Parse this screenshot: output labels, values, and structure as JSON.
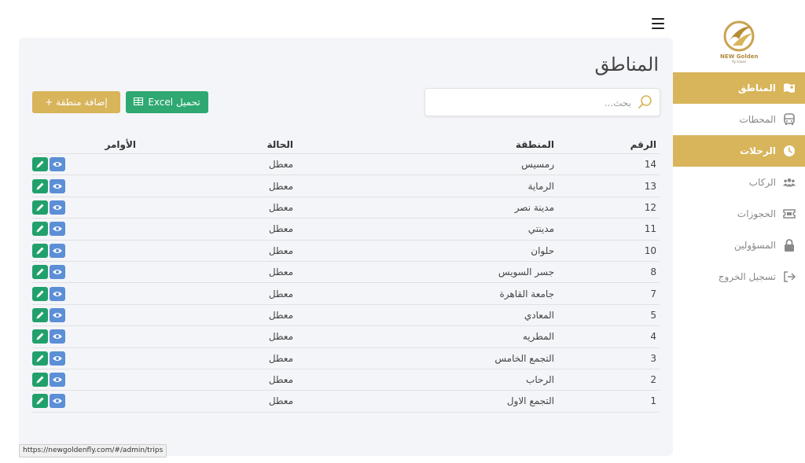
{
  "logo": {
    "title": "NEW Golden",
    "subtitle": "fly travel"
  },
  "sidebar": {
    "items": [
      {
        "label": "المناطق",
        "icon": "map-icon",
        "active": true
      },
      {
        "label": "المحطات",
        "icon": "bus-icon",
        "active": false
      },
      {
        "label": "الرحلات",
        "icon": "clock-icon",
        "active": true
      },
      {
        "label": "الركاب",
        "icon": "users-icon",
        "active": false
      },
      {
        "label": "الحجوزات",
        "icon": "ticket-icon",
        "active": false
      },
      {
        "label": "المسؤولين",
        "icon": "lock-icon",
        "active": false
      },
      {
        "label": "تسجيل الخروج",
        "icon": "logout-icon",
        "active": false
      }
    ]
  },
  "main": {
    "title": "المناطق",
    "search": {
      "placeholder": "بحث...",
      "value": ""
    },
    "buttons": {
      "excel": "تحميل Excel",
      "add": "إضافة منطقة +"
    },
    "table": {
      "headers": {
        "number": "الرقم",
        "area": "المنطقة",
        "status": "الحالة",
        "actions": "الأوامر"
      },
      "rows": [
        {
          "number": "14",
          "area": "رمسيس",
          "status": "معطل"
        },
        {
          "number": "13",
          "area": "الرماية",
          "status": "معطل"
        },
        {
          "number": "12",
          "area": "مدينة نصر",
          "status": "معطل"
        },
        {
          "number": "11",
          "area": "مدينتي",
          "status": "معطل"
        },
        {
          "number": "10",
          "area": "حلوان",
          "status": "معطل"
        },
        {
          "number": "8",
          "area": "جسر السويس",
          "status": "معطل"
        },
        {
          "number": "7",
          "area": "جامعة القاهرة",
          "status": "معطل"
        },
        {
          "number": "5",
          "area": "المعادي",
          "status": "معطل"
        },
        {
          "number": "4",
          "area": "المطريه",
          "status": "معطل"
        },
        {
          "number": "3",
          "area": "التجمع الخامس",
          "status": "معطل"
        },
        {
          "number": "2",
          "area": "الرحاب",
          "status": "معطل"
        },
        {
          "number": "1",
          "area": "التجمع الاول",
          "status": "معطل"
        }
      ]
    }
  },
  "status_bar": {
    "url": "https://newgoldenfly.com/#/admin/trips"
  },
  "colors": {
    "accent": "#d8b45a",
    "excel": "#2fa872",
    "edit": "#22a06b",
    "view": "#5b8fd6",
    "panel": "#f4f5f9"
  }
}
